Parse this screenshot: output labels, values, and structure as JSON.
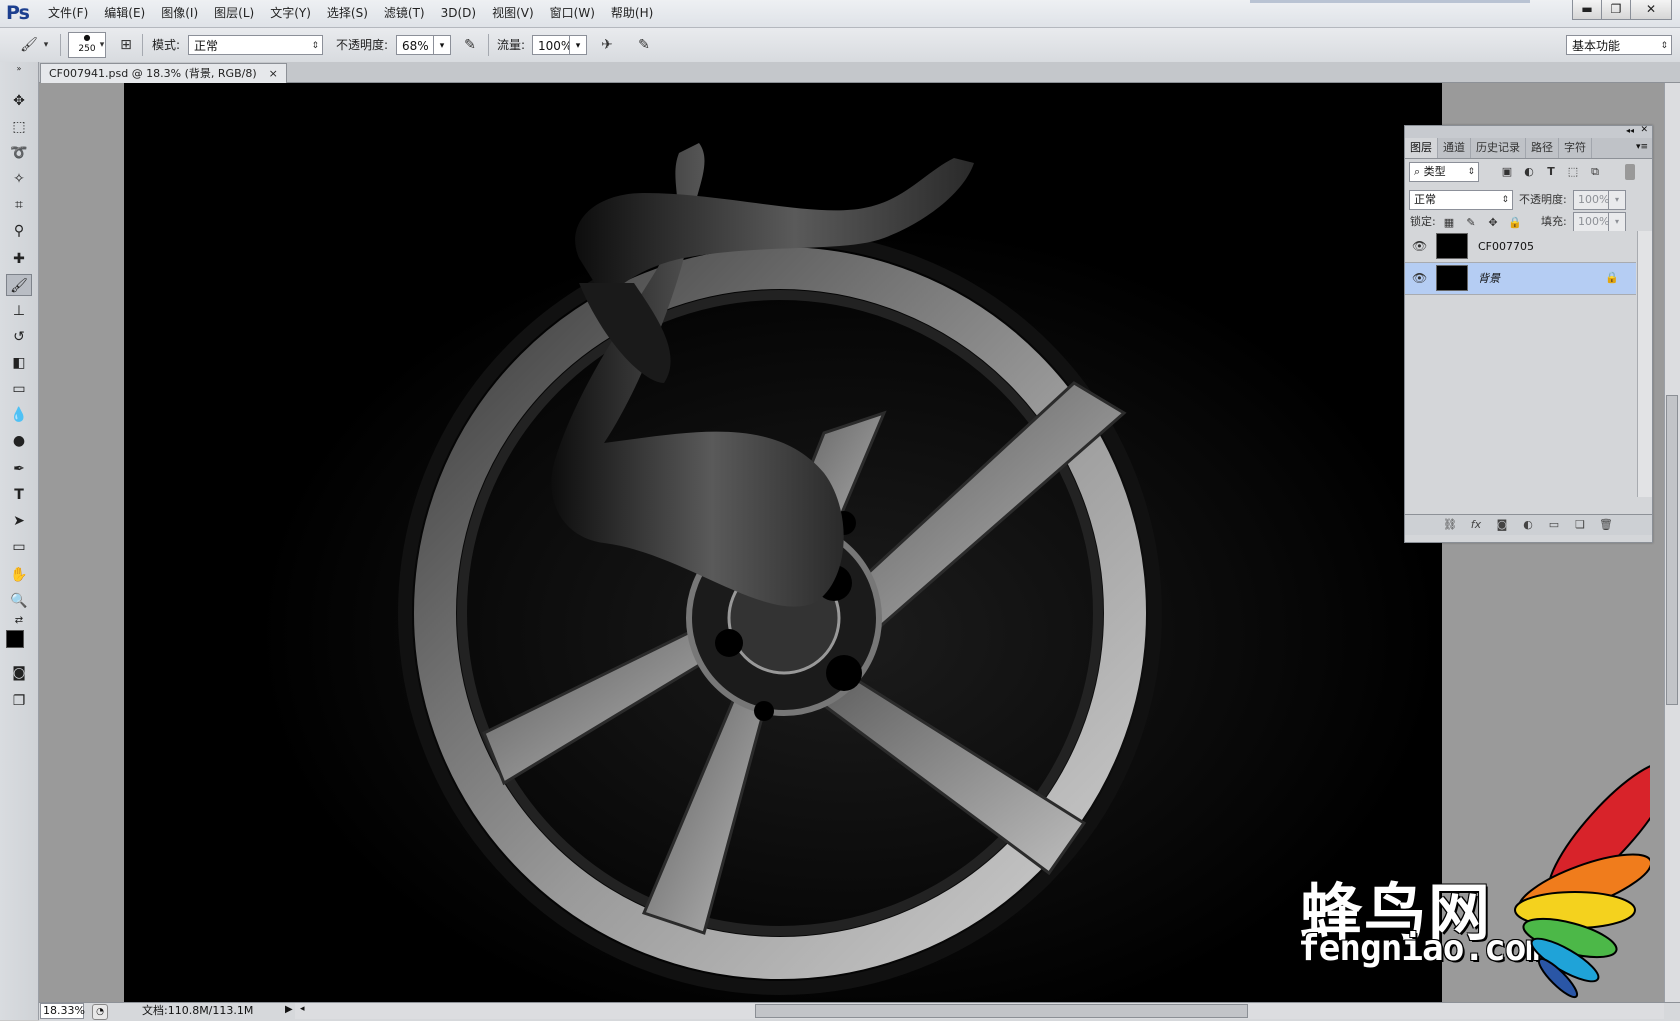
{
  "app": {
    "logo": "Ps"
  },
  "menubar": {
    "items": [
      "文件(F)",
      "编辑(E)",
      "图像(I)",
      "图层(L)",
      "文字(Y)",
      "选择(S)",
      "滤镜(T)",
      "3D(D)",
      "视图(V)",
      "窗口(W)",
      "帮助(H)"
    ],
    "window_controls": {
      "minimize": "▬",
      "restore": "❐",
      "close": "✕"
    }
  },
  "options": {
    "brush_size": "250",
    "mode_label": "模式:",
    "mode_value": "正常",
    "opacity_label": "不透明度:",
    "opacity_value": "68%",
    "flow_label": "流量:",
    "flow_value": "100%",
    "workspace": "基本功能"
  },
  "document": {
    "tab_title": "CF007941.psd @ 18.3% (背景, RGB/8)",
    "tab_close": "×"
  },
  "layers_panel": {
    "tabs": [
      "图层",
      "通道",
      "历史记录",
      "路径",
      "字符"
    ],
    "active_tab": "图层",
    "filter_type": "类型",
    "blend_mode": "正常",
    "opacity_label": "不透明度:",
    "opacity_value": "100%",
    "lock_label": "锁定:",
    "fill_label": "填充:",
    "fill_value": "100%",
    "layers": [
      {
        "name": "CF007705",
        "selected": false,
        "locked": false
      },
      {
        "name": "背景",
        "selected": true,
        "locked": true
      }
    ]
  },
  "status": {
    "zoom": "18.33%",
    "doc_info": "文档:110.8M/113.1M"
  },
  "watermark": {
    "chinese": "蜂鸟网",
    "url": "fengniao.com",
    "colors": [
      "#d8232a",
      "#f07c1c",
      "#f4d21e",
      "#4cb848",
      "#1fa3d8",
      "#2a56a6"
    ]
  }
}
